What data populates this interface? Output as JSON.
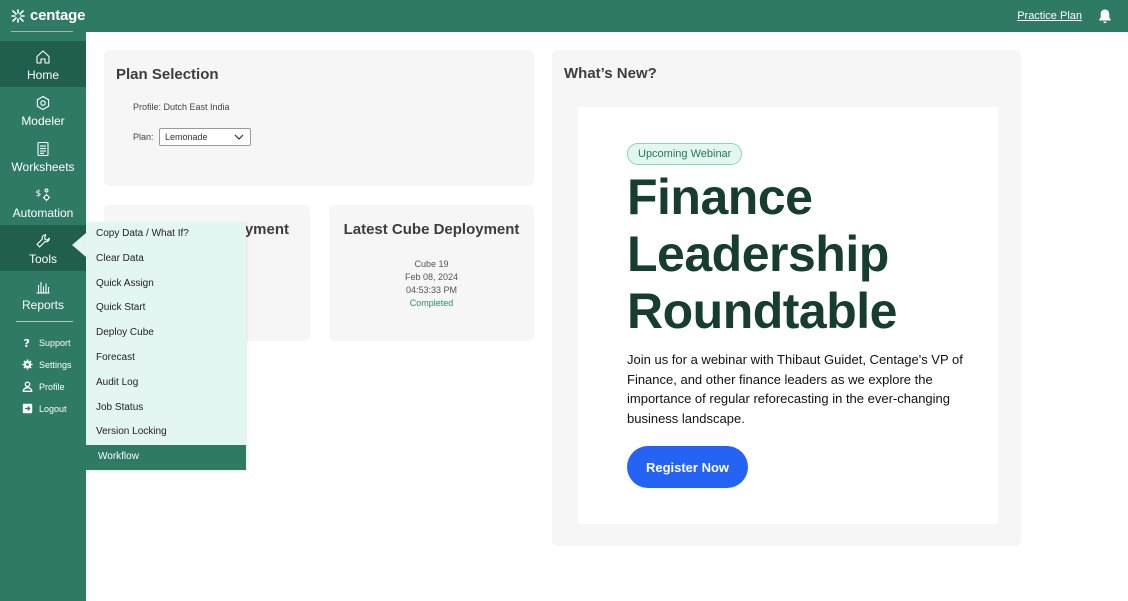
{
  "app": {
    "logo_text": "centage"
  },
  "header": {
    "practice_link": "Practice Plan"
  },
  "sidebar": {
    "items": [
      {
        "label": "Home",
        "icon": "home-icon",
        "active": true
      },
      {
        "label": "Modeler",
        "icon": "modeler-icon"
      },
      {
        "label": "Worksheets",
        "icon": "worksheets-icon"
      },
      {
        "label": "Automation",
        "icon": "automation-icon"
      },
      {
        "label": "Tools",
        "icon": "tools-icon",
        "open": true
      },
      {
        "label": "Reports",
        "icon": "reports-icon"
      }
    ],
    "utilities": [
      {
        "label": "Support",
        "icon": "help-icon"
      },
      {
        "label": "Settings",
        "icon": "gear-icon"
      },
      {
        "label": "Profile",
        "icon": "user-icon"
      },
      {
        "label": "Logout",
        "icon": "logout-icon"
      }
    ]
  },
  "plan_selection": {
    "title": "Plan Selection",
    "profile": "Profile: Dutch East India",
    "plan_label": "Plan:",
    "plan_value": "Lemonade"
  },
  "deployment_left": {
    "title_fragment": "oyment"
  },
  "latest_cube": {
    "title": "Latest Cube Deployment",
    "cube": "Cube 19",
    "date": "Feb 08, 2024",
    "time": "04:53:33 PM",
    "status": "Completed"
  },
  "whats_new": {
    "title": "What’s New?",
    "badge": "Upcoming Webinar",
    "headline": "Finance Leadership Roundtable",
    "blurb": "Join us for a webinar with Thibaut Guidet, Centage's VP of Finance, and other finance leaders as we explore the importance of regular reforecasting in the ever-changing business landscape.",
    "cta": "Register Now"
  },
  "tools_menu": {
    "items": [
      "Copy Data / What If?",
      "Clear Data",
      "Quick Assign",
      "Quick Start",
      "Deploy Cube",
      "Forecast",
      "Audit Log",
      "Job Status",
      "Version Locking",
      "Workflow"
    ],
    "selected": "Workflow"
  },
  "colors": {
    "brand": "#2e7a64",
    "brand_dark": "#205f4d",
    "menu_bg": "#e3f6f1",
    "cta": "#2563f5",
    "headline": "#163d30"
  }
}
